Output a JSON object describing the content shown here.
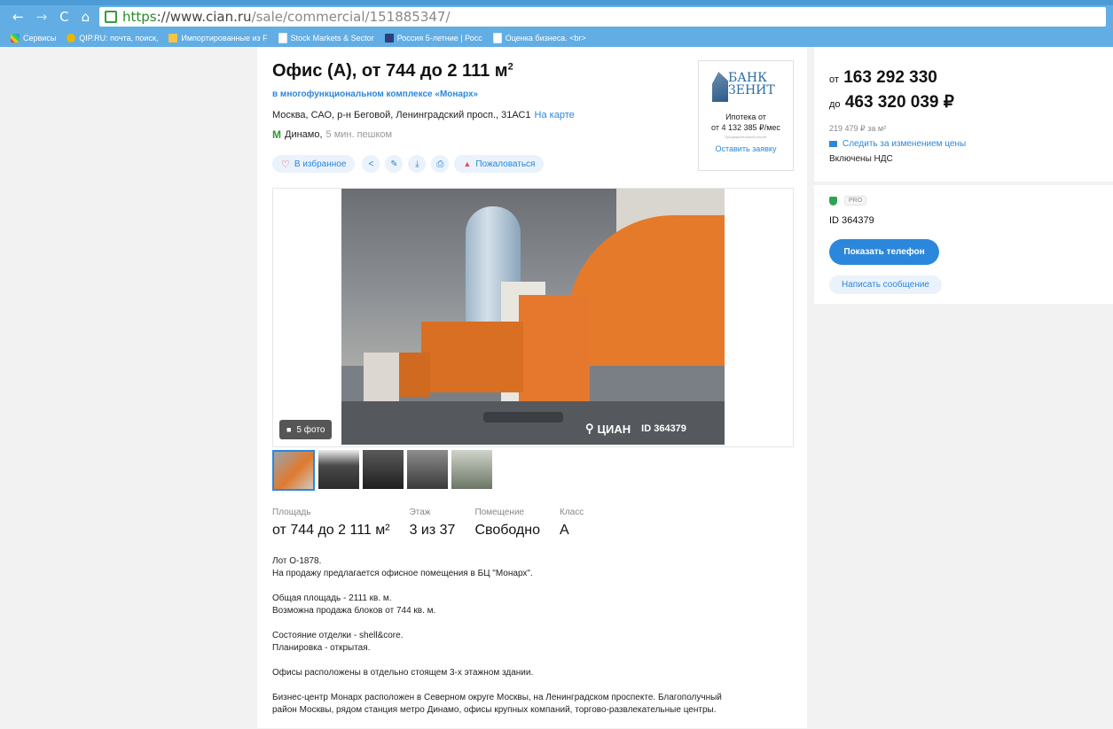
{
  "browser": {
    "url_scheme": "https",
    "url_domain": "://www.cian.ru",
    "url_path": "/sale/commercial/151885347/",
    "nav": {
      "back": "←",
      "forward": "→",
      "reload": "C",
      "home": "⌂"
    },
    "bookmarks": [
      {
        "label": "Сервисы",
        "icon": "apps-icon"
      },
      {
        "label": "QIP.RU: почта, поиск,",
        "icon": "qip-icon"
      },
      {
        "label": "Импортированные из F",
        "icon": "folder-icon"
      },
      {
        "label": "Stock Markets & Sector",
        "icon": "page-icon"
      },
      {
        "label": "Россия 5-летние | Росс",
        "icon": "rs-icon"
      },
      {
        "label": "Оценка бизнеса. <br>",
        "icon": "page-icon"
      }
    ]
  },
  "listing": {
    "title_main": "Офис (А), от 744 до 2 111 м",
    "title_sup": "2",
    "complex": "в многофункциональном комплексе «Монарх»",
    "address": "Москва, САО, р-н Беговой, Ленинградский просп., 31АС1",
    "map_link": "На карте",
    "metro_icon": "М",
    "metro_station": "Динамо,",
    "metro_walk": "5 мин. пешком",
    "actions": {
      "favorite": "В избранное",
      "share_icon": "<",
      "edit_icon": "✎",
      "download_icon": "⤓",
      "print_icon": "⎙",
      "complain": "Пожаловаться"
    }
  },
  "bank": {
    "name_line1": "БАНК",
    "name_line2": "ЗЕНИТ",
    "text1": "Ипотека от",
    "text2": "от 4 132 385 ₽/мес",
    "fine": "Предварительный расчёт",
    "link": "Оставить заявку"
  },
  "gallery": {
    "photo_count": "5 фото",
    "watermark_brand": "ЦИАН",
    "watermark_id": "ID 364379"
  },
  "params": [
    {
      "label": "Площадь",
      "value": "от 744 до 2 111 м²"
    },
    {
      "label": "Этаж",
      "value": "3 из 37"
    },
    {
      "label": "Помещение",
      "value": "Свободно"
    },
    {
      "label": "Класс",
      "value": "А"
    }
  ],
  "description": {
    "p1_l1": "Лот О-1878.",
    "p1_l2": "На продажу предлагается офисное помещения в БЦ \"Монарх\".",
    "p2_l1": "Общая площадь - 2111 кв. м.",
    "p2_l2": "Возможна продажа блоков от 744 кв. м.",
    "p3_l1": "Состояние отделки - shell&core.",
    "p3_l2": "Планировка - открытая.",
    "p4": "Офисы расположены в отдельно стоящем 3-х этажном здании.",
    "p5_l1": "Бизнес-центр Монарх расположен в Северном округе Москвы, на Ленинградском проспекте. Благополучный",
    "p5_l2": "район Москвы, рядом станция метро Динамо, офисы крупных компаний, торгово-развлекательные центры."
  },
  "price": {
    "from_prefix": "от",
    "from_value": "163 292 330",
    "to_prefix": "до",
    "to_value": "463 320 039 ₽",
    "per_m": "219 479 ₽ за м²",
    "follow": "Следить за изменением цены",
    "vat": "Включены НДС"
  },
  "agent": {
    "pro": "PRO",
    "id": "ID 364379",
    "phone_button": "Показать телефон",
    "message_button": "Написать сообщение"
  },
  "colors": {
    "chrome": "#62aee4",
    "link": "#2b87db",
    "button": "#2b87db",
    "metro": "#2e9a2e",
    "complain": "#e94a57"
  }
}
